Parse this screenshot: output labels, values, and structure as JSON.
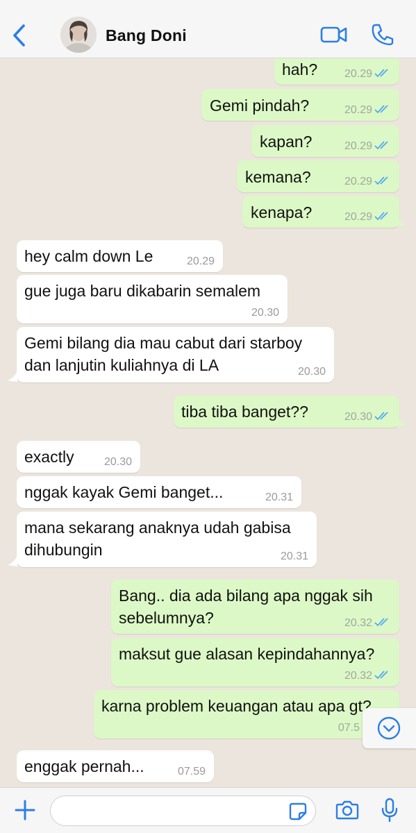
{
  "header": {
    "back_icon": "chevron-left-icon",
    "contact_name": "Bang Doni",
    "video_icon": "video-camera-icon",
    "call_icon": "phone-icon"
  },
  "colors": {
    "accent": "#2a7ee5",
    "outgoing_bubble": "#dcf8c6",
    "incoming_bubble": "#ffffff",
    "chat_background": "#ece5dd",
    "read_ticks": "#53a8f0"
  },
  "messages": [
    {
      "direction": "out",
      "text": "hah?",
      "time": "20.29",
      "status": "read"
    },
    {
      "direction": "out",
      "text": "Gemi pindah?",
      "time": "20.29",
      "status": "read"
    },
    {
      "direction": "out",
      "text": "kapan?",
      "time": "20.29",
      "status": "read"
    },
    {
      "direction": "out",
      "text": "kemana?",
      "time": "20.29",
      "status": "read"
    },
    {
      "direction": "out",
      "text": "kenapa?",
      "time": "20.29",
      "status": "read"
    },
    {
      "direction": "in",
      "text": "hey calm down Le",
      "time": "20.29"
    },
    {
      "direction": "in",
      "text": "gue juga baru dikabarin semalem",
      "time": "20.30"
    },
    {
      "direction": "in",
      "text": "Gemi bilang dia mau cabut dari starboy dan lanjutin kuliahnya di LA",
      "time": "20.30"
    },
    {
      "direction": "out",
      "text": "tiba tiba banget??",
      "time": "20.30",
      "status": "read"
    },
    {
      "direction": "in",
      "text": "exactly",
      "time": "20.30"
    },
    {
      "direction": "in",
      "text": "nggak kayak Gemi banget...",
      "time": "20.31"
    },
    {
      "direction": "in",
      "text": "mana sekarang anaknya udah gabisa dihubungin",
      "time": "20.31"
    },
    {
      "direction": "out",
      "text": "Bang.. dia ada bilang apa nggak sih sebelumnya?",
      "time": "20.32",
      "status": "read"
    },
    {
      "direction": "out",
      "text": "maksut gue alasan kepindahannya?",
      "time": "20.32",
      "status": "read"
    },
    {
      "direction": "out",
      "text": "karna problem keuangan atau apa gt?",
      "time": "07.5",
      "status": "read"
    },
    {
      "direction": "in",
      "text": "enggak pernah...",
      "time": "07.59"
    }
  ],
  "scroll_button": {
    "icon": "chevron-down-circle-icon"
  },
  "input_bar": {
    "plus_icon": "plus-icon",
    "message_placeholder": "",
    "message_value": "",
    "sticker_icon": "sticker-icon",
    "camera_icon": "camera-icon",
    "mic_icon": "microphone-icon"
  }
}
